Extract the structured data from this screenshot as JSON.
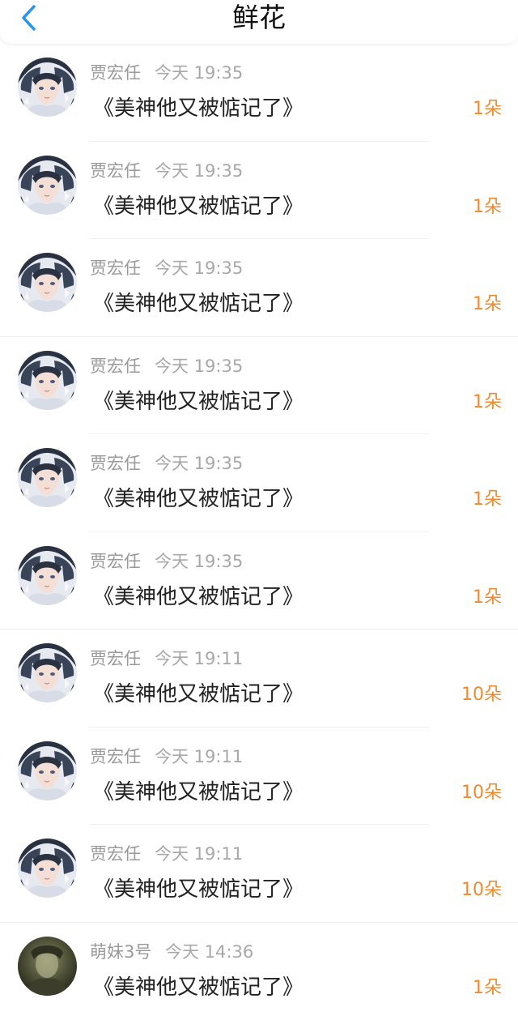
{
  "header": {
    "title": "鲜花",
    "back_icon": "chevron-left-icon",
    "accent_color": "#2b95e9"
  },
  "count_color": "#ee8b2f",
  "items": [
    {
      "user": "贾宏任",
      "time": "今天 19:35",
      "book": "《美神他又被惦记了》",
      "count": "1朵",
      "avatar": "anime-avatar"
    },
    {
      "user": "贾宏任",
      "time": "今天 19:35",
      "book": "《美神他又被惦记了》",
      "count": "1朵",
      "avatar": "anime-avatar"
    },
    {
      "user": "贾宏任",
      "time": "今天 19:35",
      "book": "《美神他又被惦记了》",
      "count": "1朵",
      "avatar": "anime-avatar"
    },
    {
      "user": "贾宏任",
      "time": "今天 19:35",
      "book": "《美神他又被惦记了》",
      "count": "1朵",
      "avatar": "anime-avatar"
    },
    {
      "user": "贾宏任",
      "time": "今天 19:35",
      "book": "《美神他又被惦记了》",
      "count": "1朵",
      "avatar": "anime-avatar"
    },
    {
      "user": "贾宏任",
      "time": "今天 19:35",
      "book": "《美神他又被惦记了》",
      "count": "1朵",
      "avatar": "anime-avatar"
    },
    {
      "user": "贾宏任",
      "time": "今天 19:11",
      "book": "《美神他又被惦记了》",
      "count": "10朵",
      "avatar": "anime-avatar"
    },
    {
      "user": "贾宏任",
      "time": "今天 19:11",
      "book": "《美神他又被惦记了》",
      "count": "10朵",
      "avatar": "anime-avatar"
    },
    {
      "user": "贾宏任",
      "time": "今天 19:11",
      "book": "《美神他又被惦记了》",
      "count": "10朵",
      "avatar": "anime-avatar"
    },
    {
      "user": "萌妹3号",
      "time": "今天 14:36",
      "book": "《美神他又被惦记了》",
      "count": "1朵",
      "avatar": "dark-photo-avatar"
    }
  ]
}
